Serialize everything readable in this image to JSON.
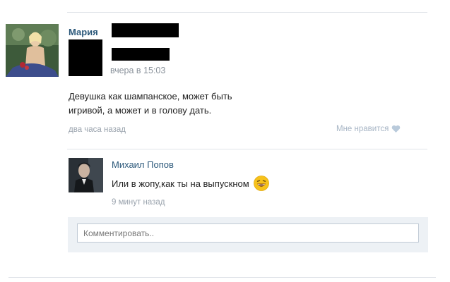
{
  "post": {
    "author": "Мария",
    "sublabel_time": "вчера в 15:03",
    "text_line1": "Девушка как шампанское, может быть",
    "text_line2": "игривой, а может и в голову дать.",
    "time": "два часа назад",
    "like_label": "Мне нравится"
  },
  "reply": {
    "author": "Михаил Попов",
    "text": "Или в жопу,как ты на выпускном",
    "time": "9 минут назад"
  },
  "comment": {
    "placeholder": "Комментировать.."
  }
}
